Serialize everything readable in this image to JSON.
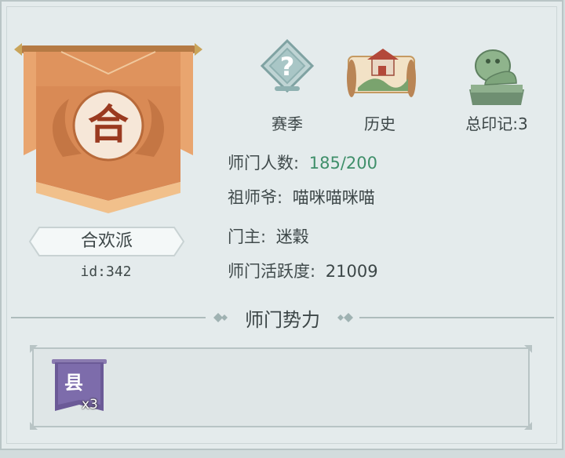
{
  "sect": {
    "emblem_char": "合",
    "name": "合欢派",
    "id_label": "id:342"
  },
  "actions": [
    {
      "label": "赛季",
      "icon": "season-help-icon"
    },
    {
      "label": "历史",
      "icon": "history-scroll-icon"
    },
    {
      "label": "总印记:3",
      "icon": "seal-lion-icon"
    }
  ],
  "info": {
    "members_label": "师门人数:",
    "members_value": "185/200",
    "founder_label": "祖师爷:",
    "founder_value": "喵咪喵咪喵",
    "leader_label": "门主:",
    "leader_value": "迷穀",
    "activity_label": "师门活跃度:",
    "activity_value": "21009"
  },
  "influence": {
    "title": "师门势力",
    "badges": [
      {
        "char": "县",
        "count": "x3"
      }
    ]
  },
  "colors": {
    "banner": "#d98a55",
    "accent_green": "#3f8f6a",
    "badge_purple": "#6b5a97"
  }
}
